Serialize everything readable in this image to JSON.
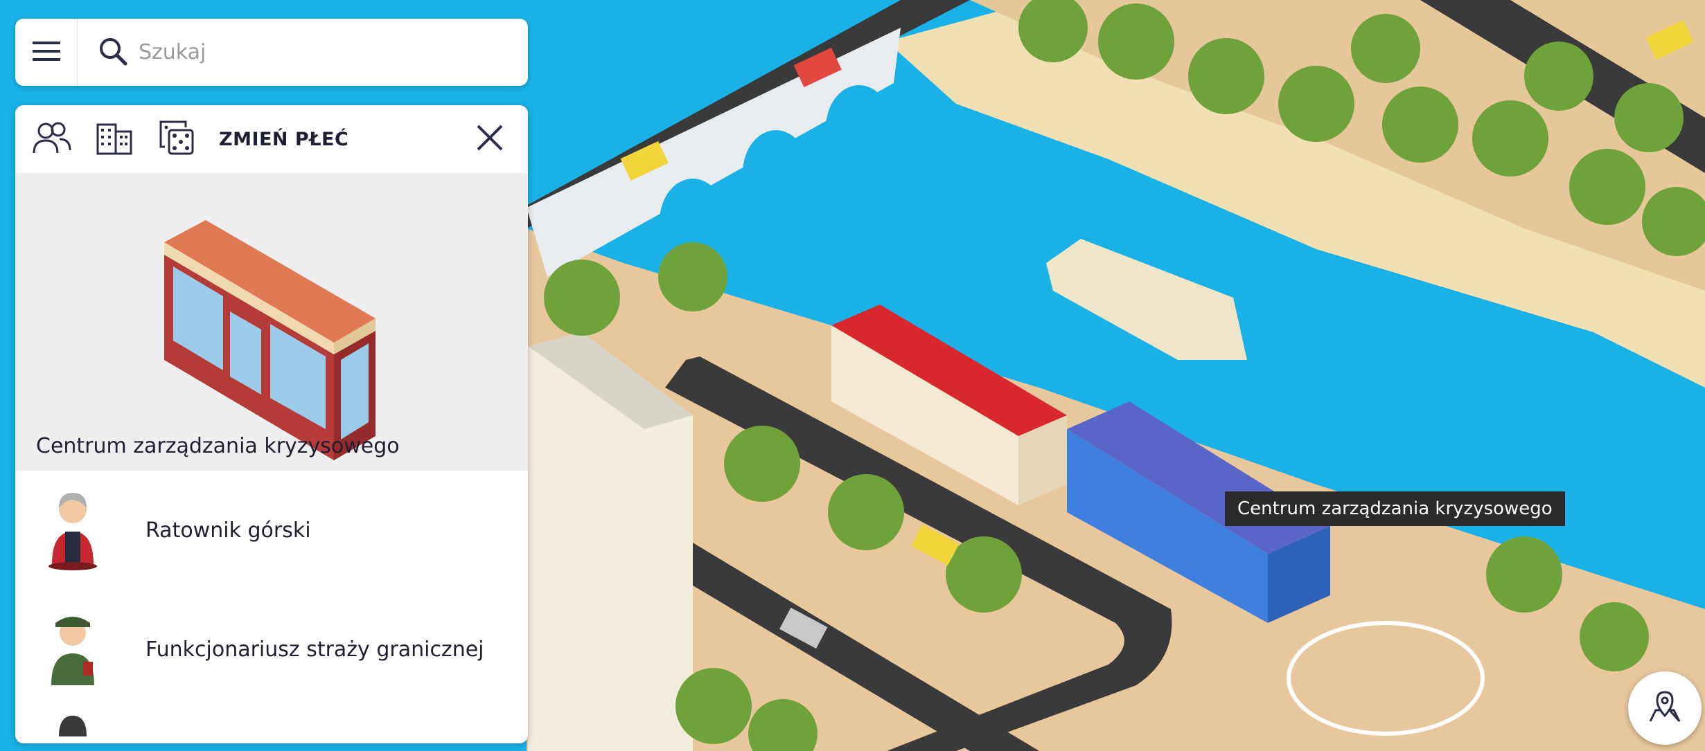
{
  "search": {
    "placeholder": "Szukaj"
  },
  "panel": {
    "toolbar": {
      "gender_label": "ZMIEŃ PŁEĆ"
    },
    "building_title": "Centrum zarządzania kryzysowego",
    "characters": [
      {
        "label": "Ratownik górski"
      },
      {
        "label": "Funkcjonariusz straży granicznej"
      }
    ]
  },
  "map": {
    "tooltip": "Centrum zarządzania kryzysowego"
  },
  "icons": {
    "menu": "hamburger-icon",
    "search": "search-icon",
    "people": "people-icon",
    "building": "building-icon",
    "dice": "dice-icon",
    "close": "close-icon",
    "location": "map-pin-icon"
  },
  "colors": {
    "water": "#1ab2e6",
    "sand": "#eed8a8",
    "grass": "#e8c79d",
    "road": "#3a3a3a",
    "tree": "#6fa23a"
  }
}
